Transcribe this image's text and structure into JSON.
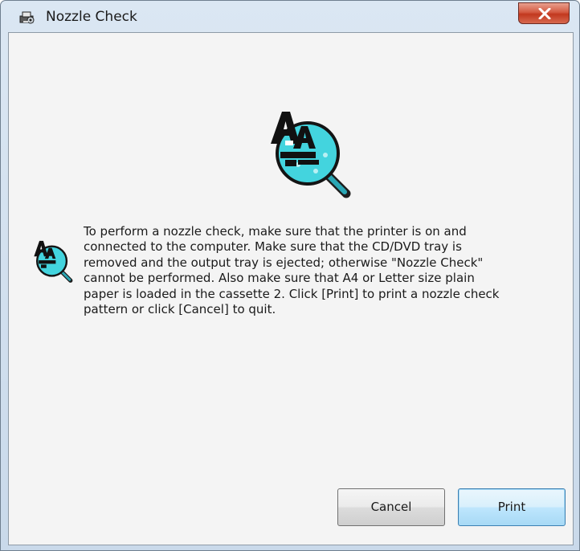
{
  "window": {
    "title": "Nozzle Check",
    "close_label": "×"
  },
  "icons": {
    "title_icon": "printer-gear-icon",
    "main_icon": "nozzle-check-magnifier-icon",
    "message_icon": "nozzle-check-magnifier-icon",
    "close_icon": "close-icon"
  },
  "message": {
    "line1": "To perform a nozzle check, make sure that the printer is on and",
    "line2": "connected to the computer. Make sure that the CD/DVD tray is",
    "line3": "removed and the output tray is ejected; otherwise \"Nozzle Check\"",
    "line4": "cannot be performed. Also make sure that A4 or Letter size plain",
    "line5": "paper is loaded in the cassette 2. Click [Print] to print a nozzle check",
    "line6": "pattern or click [Cancel] to quit."
  },
  "buttons": {
    "cancel": "Cancel",
    "print": "Print"
  },
  "colors": {
    "titlebar": "#dbe7f3",
    "close_button": "#c2381f",
    "client_bg": "#f4f4f4",
    "icon_lens": "#3fd3dc",
    "default_button_border": "#3c7fb1"
  }
}
